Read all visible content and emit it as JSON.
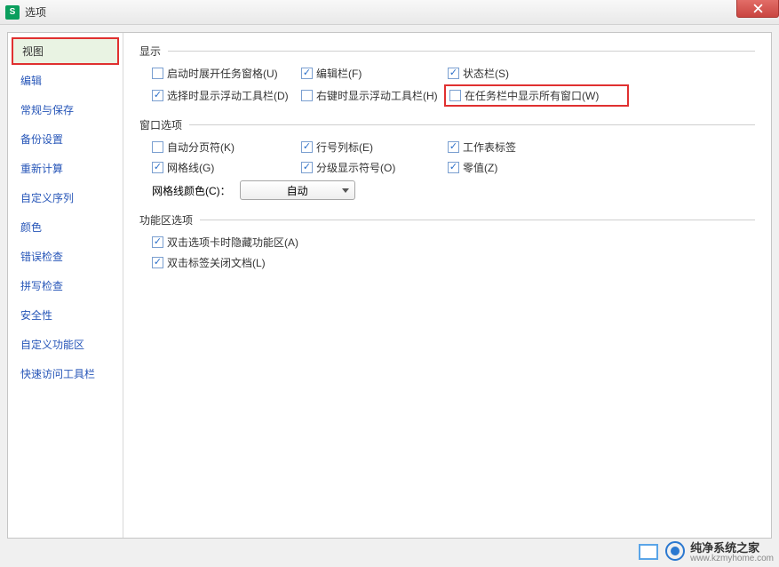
{
  "title": "选项",
  "sidebar": {
    "items": [
      {
        "label": "视图",
        "active": true
      },
      {
        "label": "编辑"
      },
      {
        "label": "常规与保存"
      },
      {
        "label": "备份设置"
      },
      {
        "label": "重新计算"
      },
      {
        "label": "自定义序列"
      },
      {
        "label": "颜色"
      },
      {
        "label": "错误检查"
      },
      {
        "label": "拼写检查"
      },
      {
        "label": "安全性"
      },
      {
        "label": "自定义功能区"
      },
      {
        "label": "快速访问工具栏"
      }
    ]
  },
  "sections": {
    "display": {
      "legend": "显示",
      "options": [
        {
          "label": "启动时展开任务窗格(U)",
          "checked": false
        },
        {
          "label": "编辑栏(F)",
          "checked": true
        },
        {
          "label": "状态栏(S)",
          "checked": true
        },
        {
          "label": "选择时显示浮动工具栏(D)",
          "checked": true
        },
        {
          "label": "右键时显示浮动工具栏(H)",
          "checked": false
        },
        {
          "label": "在任务栏中显示所有窗口(W)",
          "checked": false,
          "highlighted": true
        }
      ]
    },
    "windowopt": {
      "legend": "窗口选项",
      "options": [
        {
          "label": "自动分页符(K)",
          "checked": false
        },
        {
          "label": "行号列标(E)",
          "checked": true
        },
        {
          "label": "工作表标签",
          "checked": true
        },
        {
          "label": "网格线(G)",
          "checked": true
        },
        {
          "label": "分级显示符号(O)",
          "checked": true
        },
        {
          "label": "零值(Z)",
          "checked": true
        }
      ],
      "gridcolor_label": "网格线颜色(C)：",
      "gridcolor_value": "自动"
    },
    "ribbon": {
      "legend": "功能区选项",
      "options": [
        {
          "label": "双击选项卡时隐藏功能区(A)",
          "checked": true
        },
        {
          "label": "双击标签关闭文档(L)",
          "checked": true
        }
      ]
    }
  },
  "watermark": {
    "name": "纯净系统之家",
    "url": "www.kzmyhome.com"
  }
}
